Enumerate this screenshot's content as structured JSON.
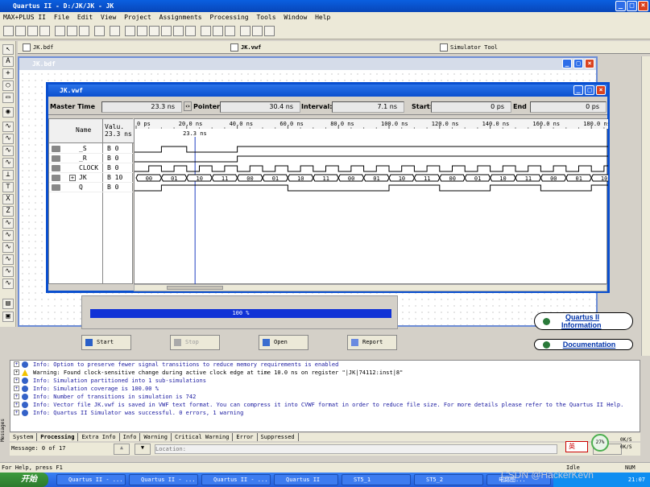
{
  "app": {
    "title": "Quartus II - D:/JK/JK - JK"
  },
  "menu": [
    "MAX+PLUS II",
    "File",
    "Edit",
    "View",
    "Project",
    "Assignments",
    "Processing",
    "Tools",
    "Window",
    "Help"
  ],
  "tabs": [
    "JK.bdf",
    "JK.vwf",
    "Simulator Tool"
  ],
  "bdf_window": {
    "title": "JK.bdf"
  },
  "vwf_window": {
    "title": "JK.vwf"
  },
  "info_bar": {
    "master_time_label": "Master Time",
    "master_time": "23.3 ns",
    "pointer_label": "Pointer:",
    "pointer": "30.4 ns",
    "interval_label": "Interval:",
    "interval": "7.1 ns",
    "start_label": "Start:",
    "start": "0 ps",
    "end_label": "End",
    "end": "0 ps"
  },
  "signal_table": {
    "name_header": "Name",
    "value_header": "Valu.",
    "value_subheader": "23.3 ns",
    "signals": [
      {
        "name": "_S",
        "value": "B 0"
      },
      {
        "name": "_R",
        "value": "B 0"
      },
      {
        "name": "CLOCK",
        "value": "B 0"
      },
      {
        "name": "JK",
        "value": "B 10"
      },
      {
        "name": "Q",
        "value": "B 0"
      }
    ]
  },
  "timeline": {
    "ticks": [
      "0 ps",
      "20.0 ns",
      "40.0 ns",
      "60.0 ns",
      "80.0 ns",
      "100.0 ns",
      "120.0 ns",
      "140.0 ns",
      "160.0 ns",
      "180.0 ns"
    ],
    "cursor_label": "23.3 ns",
    "jk_bus": [
      "00",
      "01",
      "10",
      "11",
      "00",
      "01",
      "10",
      "11",
      "00",
      "01",
      "10",
      "11",
      "00",
      "01",
      "10",
      "11",
      "00",
      "01",
      "10"
    ]
  },
  "simulation": {
    "progress": 100,
    "progress_label": "100 %",
    "start_button": "Start",
    "stop_button": "Stop",
    "open_button": "Open",
    "report_button": "Report"
  },
  "side_links": {
    "info": "Quartus II Information",
    "info_line1": "Quartus II",
    "info_line2": "Information",
    "docs": "Documentation"
  },
  "messages": [
    {
      "type": "info",
      "text": "Info: Option to preserve fewer signal transitions to reduce memory requirements is enabled"
    },
    {
      "type": "warning",
      "text": "Warning: Found clock-sensitive change during active clock edge at time 10.0 ns on register \"|JK|74112:inst|8\""
    },
    {
      "type": "info",
      "text": "Info: Simulation partitioned into 1 sub-simulations"
    },
    {
      "type": "info",
      "text": "Info: Simulation coverage is      100.00 %"
    },
    {
      "type": "info",
      "text": "Info: Number of transitions in simulation is 742"
    },
    {
      "type": "info",
      "text": "Info: Vector file JK.vwf is saved in VWF text format. You can compress it into CVWF format in order to reduce file size. For more details please refer to the Quartus II Help."
    },
    {
      "type": "info",
      "text": "Info: Quartus II Simulator was successful. 0 errors, 1 warning"
    }
  ],
  "message_tabs": [
    "System",
    "Processing",
    "Extra Info",
    "Info",
    "Warning",
    "Critical Warning",
    "Error",
    "Suppressed"
  ],
  "message_footer": {
    "count": "Message: 0 of 17",
    "location_placeholder": "Location:"
  },
  "side_label": "Messages",
  "status_bar": {
    "help": "For Help, press F1",
    "state": "Idle",
    "num": "NUM"
  },
  "taskbar": {
    "start": "开始",
    "tasks": [
      "Quartus II - ...",
      "Quartus II - ...",
      "Quartus II - ...",
      "Quartus II",
      "ST5_1",
      "ST5_2",
      "电路图..."
    ],
    "tray": {
      "ime": "英",
      "cpu": "27%",
      "net1": "0K/S",
      "net2": "0K/S",
      "clock": "21:07"
    }
  },
  "watermark": "CSDN @HackerKevn"
}
